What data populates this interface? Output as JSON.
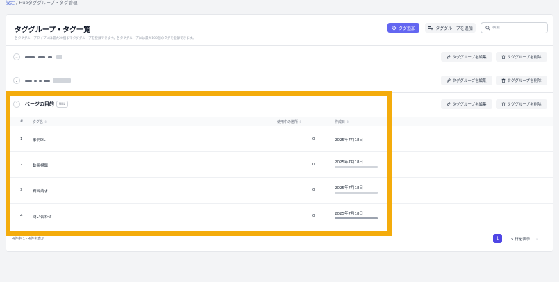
{
  "breadcrumb": {
    "root": "設定",
    "separator": "/",
    "current": "Hubタググループ・タグ管理"
  },
  "header": {
    "title": "タググループ・タグ一覧",
    "description": "各タググループタイプには最大20個までタググループを登録できます。各タググループには最大100個のタグを登録できます。",
    "add_tag_label": "タグ追加",
    "add_group_label": "タググループを追加",
    "search_placeholder": "検索"
  },
  "groups": [
    {
      "name": "",
      "badge": "",
      "redacted": true,
      "expanded": false
    },
    {
      "name": "",
      "badge": "",
      "redacted": true,
      "expanded": false
    },
    {
      "name": "ページの目的",
      "badge": "URL",
      "redacted": false,
      "expanded": true
    }
  ],
  "actions": {
    "edit_label": "タググループを編集",
    "delete_label": "タググループを削除"
  },
  "table": {
    "columns": [
      "#",
      "タグ名",
      "使用中の箇所",
      "作成日"
    ],
    "rows": [
      {
        "num": "1",
        "name": "事例DL",
        "count": "0",
        "date": "2025年7月18日"
      },
      {
        "num": "2",
        "name": "動画視聴",
        "count": "0",
        "date": "2025年7月18日"
      },
      {
        "num": "3",
        "name": "資料請求",
        "count": "0",
        "date": "2025年7月18日"
      },
      {
        "num": "4",
        "name": "問い合わせ",
        "count": "0",
        "date": "2025年7月18日"
      }
    ]
  },
  "pagination": {
    "summary": "4件中 1 - 4件を表示",
    "current_page": "1",
    "page_size_label": "5 行を表示"
  },
  "colors": {
    "primary": "#6366f1",
    "highlight": "#f4ac0c"
  },
  "icons": {
    "tag": "tag-icon",
    "add-group": "add-group-icon",
    "search": "search-icon",
    "edit": "pencil-icon",
    "delete": "trash-icon",
    "chevron": "chevron-icon",
    "sort": "sort-icon"
  }
}
